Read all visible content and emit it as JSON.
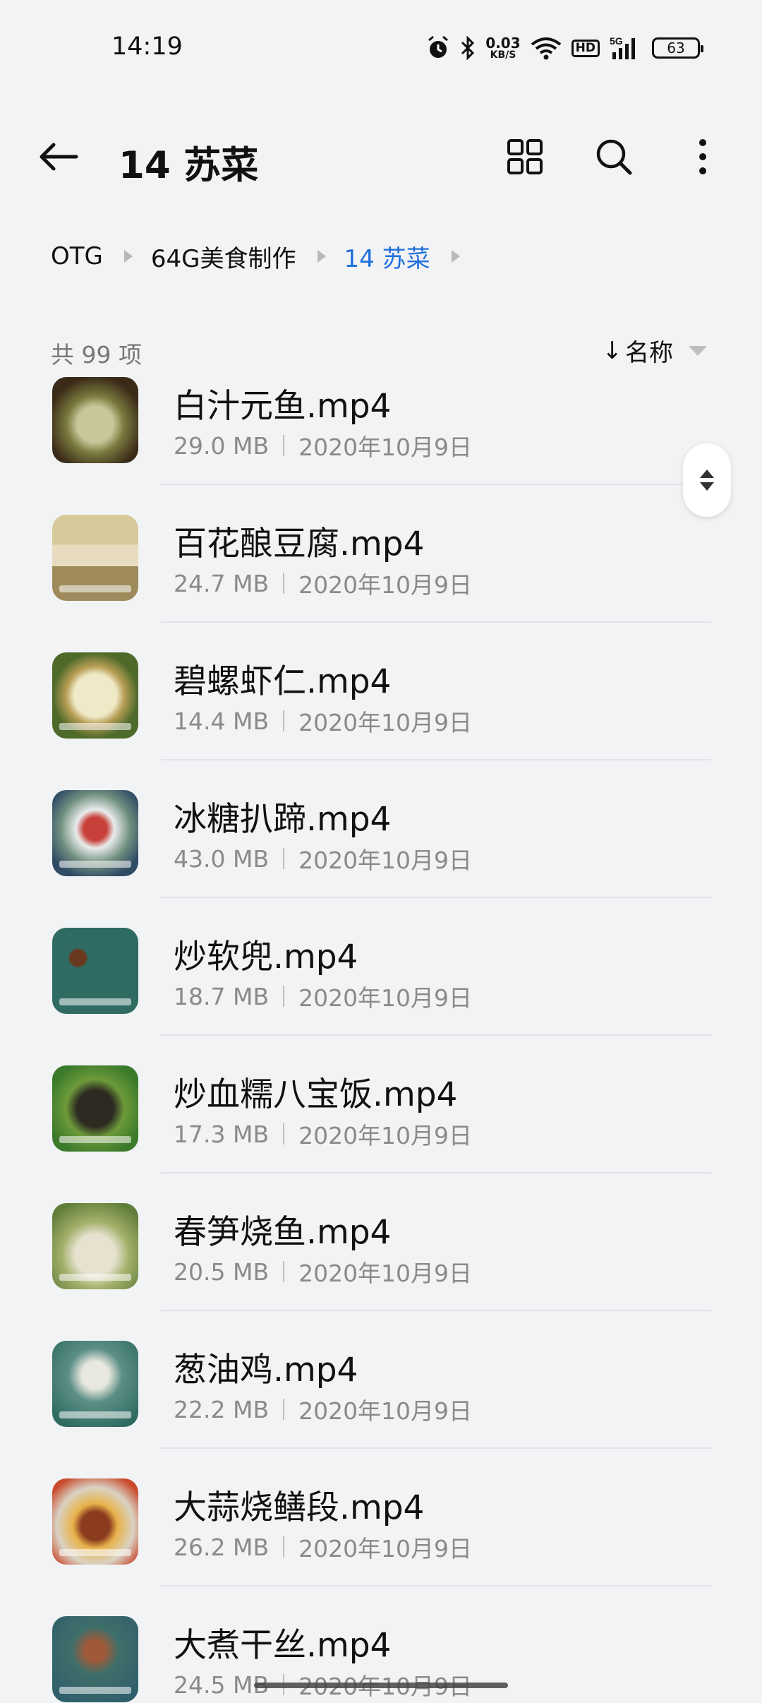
{
  "status_bar": {
    "time": "14:19",
    "net_speed_value": "0.03",
    "net_speed_unit": "KB/S",
    "hd_label": "HD",
    "signal_label": "5G",
    "battery": "63"
  },
  "toolbar": {
    "title": "14 苏菜"
  },
  "breadcrumb": {
    "items": [
      "OTG",
      "64G美食制作",
      "14 苏菜"
    ]
  },
  "list_header": {
    "count": "共 99 项",
    "sort_arrow": "↓",
    "sort_label": "名称"
  },
  "files": [
    {
      "name": "白汁元鱼.mp4",
      "size": "29.0 MB",
      "date": "2020年10月9日"
    },
    {
      "name": "百花酿豆腐.mp4",
      "size": "24.7 MB",
      "date": "2020年10月9日"
    },
    {
      "name": "碧螺虾仁.mp4",
      "size": "14.4 MB",
      "date": "2020年10月9日"
    },
    {
      "name": "冰糖扒蹄.mp4",
      "size": "43.0 MB",
      "date": "2020年10月9日"
    },
    {
      "name": "炒软兜.mp4",
      "size": "18.7 MB",
      "date": "2020年10月9日"
    },
    {
      "name": "炒血糯八宝饭.mp4",
      "size": "17.3 MB",
      "date": "2020年10月9日"
    },
    {
      "name": "春笋烧鱼.mp4",
      "size": "20.5 MB",
      "date": "2020年10月9日"
    },
    {
      "name": "葱油鸡.mp4",
      "size": "22.2 MB",
      "date": "2020年10月9日"
    },
    {
      "name": "大蒜烧鳝段.mp4",
      "size": "26.2 MB",
      "date": "2020年10月9日"
    },
    {
      "name": "大煮干丝.mp4",
      "size": "24.5 MB",
      "date": "2020年10月9日"
    }
  ]
}
